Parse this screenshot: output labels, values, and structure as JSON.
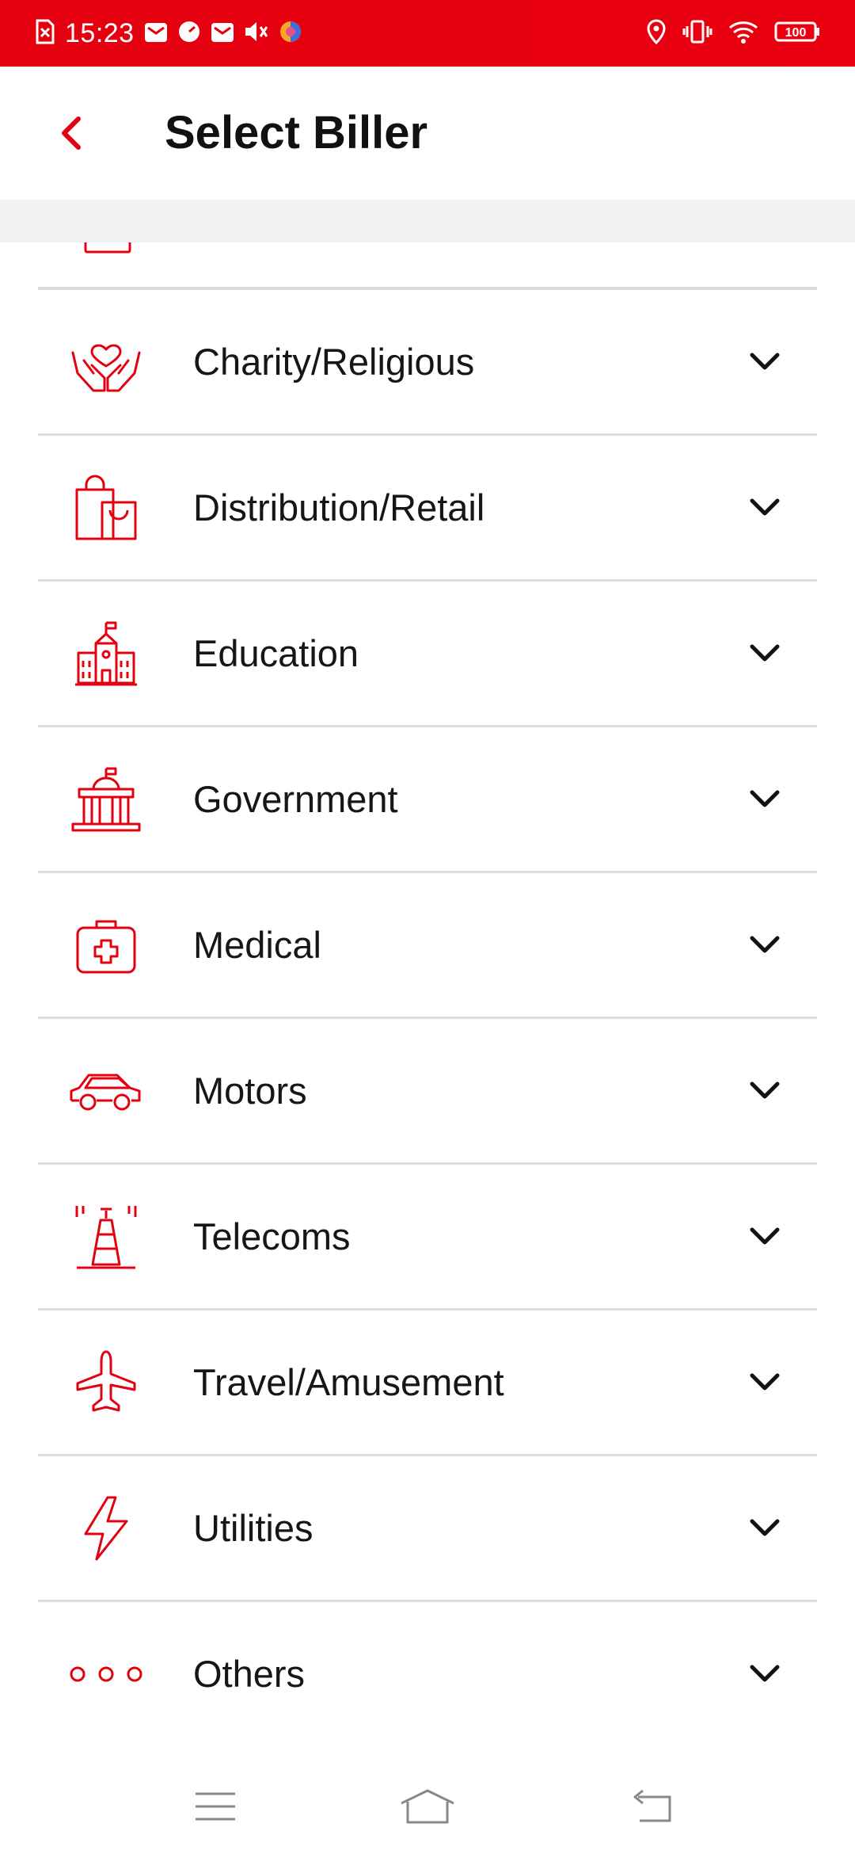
{
  "status_bar": {
    "time": "15:23",
    "battery": "100"
  },
  "header": {
    "title": "Select Biller"
  },
  "colors": {
    "accent": "#e3000f",
    "divider": "#dddddd",
    "shade": "#f1f1f1"
  },
  "categories": [
    {
      "label": "Charity/Religious",
      "icon": "charity-icon"
    },
    {
      "label": "Distribution/Retail",
      "icon": "shopping-bag-icon"
    },
    {
      "label": "Education",
      "icon": "school-icon"
    },
    {
      "label": "Government",
      "icon": "government-building-icon"
    },
    {
      "label": "Medical",
      "icon": "medical-kit-icon"
    },
    {
      "label": "Motors",
      "icon": "car-icon"
    },
    {
      "label": "Telecoms",
      "icon": "telecom-tower-icon"
    },
    {
      "label": "Travel/Amusement",
      "icon": "airplane-icon"
    },
    {
      "label": "Utilities",
      "icon": "lightning-icon"
    },
    {
      "label": "Others",
      "icon": "more-dots-icon"
    }
  ]
}
